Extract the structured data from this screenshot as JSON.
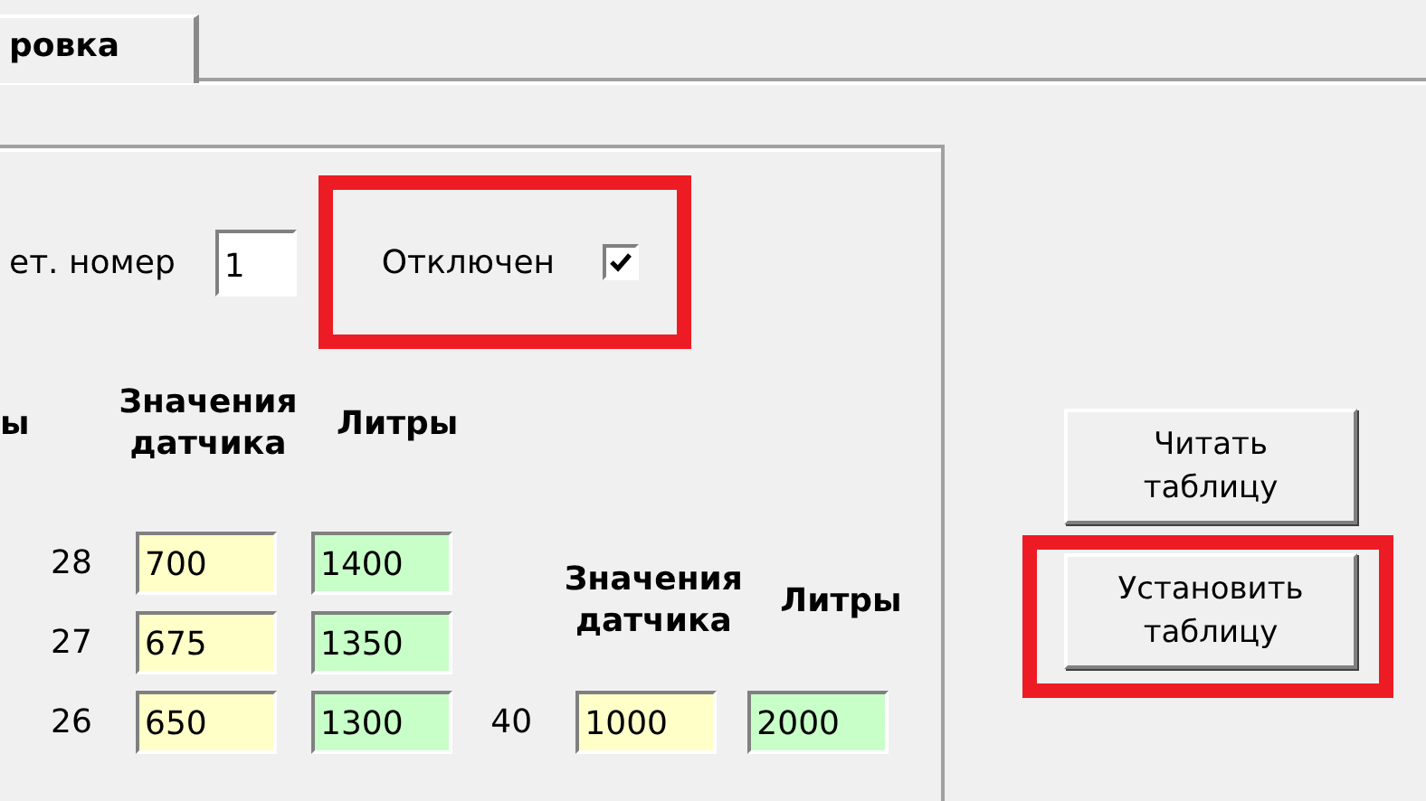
{
  "tab": {
    "label": "ровка",
    "selected": true
  },
  "device": {
    "label": "ет. номер",
    "value": "1"
  },
  "disabled_toggle": {
    "label": "Отключен",
    "checked": true,
    "highlighted": true
  },
  "table_left": {
    "headers": [
      "ы",
      "Значения датчика",
      "Литры"
    ],
    "rows": [
      {
        "index": "28",
        "sensor": "700",
        "liters": "1400"
      },
      {
        "index": "27",
        "sensor": "675",
        "liters": "1350"
      },
      {
        "index": "26",
        "sensor": "650",
        "liters": "1300"
      }
    ]
  },
  "table_right": {
    "headers": [
      "Значения датчика",
      "Литры"
    ],
    "rows": [
      {
        "index": "40",
        "sensor": "1000",
        "liters": "2000"
      }
    ]
  },
  "buttons": [
    {
      "label": "Читать таблицу",
      "highlighted": false
    },
    {
      "label": "Установить таблицу",
      "highlighted": true
    }
  ]
}
